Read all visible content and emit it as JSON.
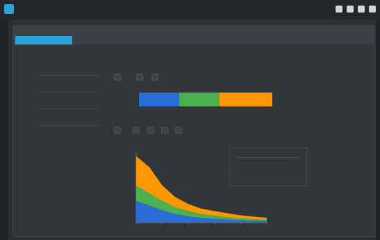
{
  "window": {
    "title": "",
    "panel_title": "",
    "controls": [
      "minimize",
      "maximize",
      "close",
      "menu"
    ]
  },
  "tabs": [
    {
      "label": ""
    },
    {
      "label": ""
    },
    {
      "label": ""
    }
  ],
  "subtabs": [
    "",
    "",
    ""
  ],
  "settings": {
    "items": [
      {
        "label": "",
        "sub": ""
      },
      {
        "label": "",
        "sub": ""
      },
      {
        "label": "",
        "sub": ""
      },
      {
        "label": "",
        "sub": ""
      },
      {
        "label": "",
        "sub": ""
      },
      {
        "label": "",
        "sub": ""
      }
    ]
  },
  "config": {
    "header": "",
    "pills": [
      "",
      "",
      ""
    ],
    "mini_label": "",
    "legend_title": "",
    "legend_pills": [
      "",
      "",
      "",
      "",
      ""
    ],
    "chart_caption": ""
  },
  "colors": {
    "accent": "#2aa3d6",
    "blue": "#2b6bd6",
    "green": "#4caf50",
    "orange": "#ff9800"
  },
  "chart_data": {
    "type": "area",
    "title": "",
    "xlabel": "",
    "ylabel": "",
    "x": [
      0,
      1,
      2,
      3,
      4,
      5,
      6,
      7,
      8,
      9,
      10
    ],
    "series": [
      {
        "color": "#2b6bd6",
        "values": [
          28,
          22,
          16,
          11,
          8,
          6,
          5,
          4,
          3,
          2.5,
          2
        ]
      },
      {
        "color": "#4caf50",
        "values": [
          20,
          16,
          12,
          9,
          7,
          5,
          4,
          3,
          2.5,
          2,
          1.6
        ]
      },
      {
        "color": "#ff9800",
        "values": [
          38,
          34,
          20,
          13,
          9,
          7,
          6,
          5,
          4,
          3.2,
          2.6
        ]
      }
    ],
    "xlim": [
      0,
      10
    ],
    "ylim": [
      0,
      90
    ]
  }
}
